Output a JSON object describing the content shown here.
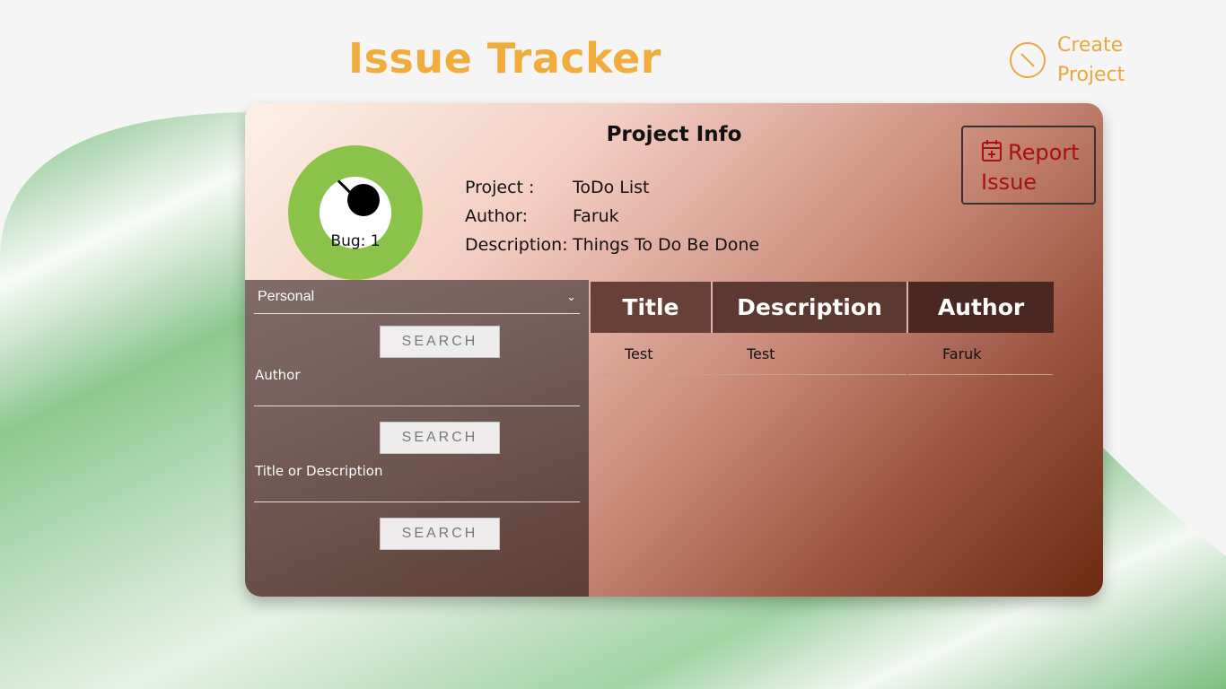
{
  "header": {
    "app_title": "Issue Tracker",
    "create_project_label": "Create Project"
  },
  "project_info": {
    "title": "Project Info",
    "bug_label": "Bug: 1",
    "rows": [
      {
        "key": "Project :",
        "value": "ToDo List"
      },
      {
        "key": "Author:",
        "value": "Faruk"
      },
      {
        "key": "Description:",
        "value": "Things To Do Be Done"
      }
    ],
    "report_button_label": "Report Issue"
  },
  "filters": {
    "select_value": "Personal",
    "search_label": "SEARCH",
    "author_label": "Author",
    "title_desc_label": "Title or Description"
  },
  "table": {
    "columns": [
      "Title",
      "Description",
      "Author"
    ],
    "rows": [
      [
        "Test",
        "Test",
        "Faruk"
      ]
    ]
  },
  "colors": {
    "title_orange": "#f0ad3c",
    "gauge_green": "#8bc34a",
    "report_red": "#a91010",
    "wave_green": "#7dbd83"
  }
}
